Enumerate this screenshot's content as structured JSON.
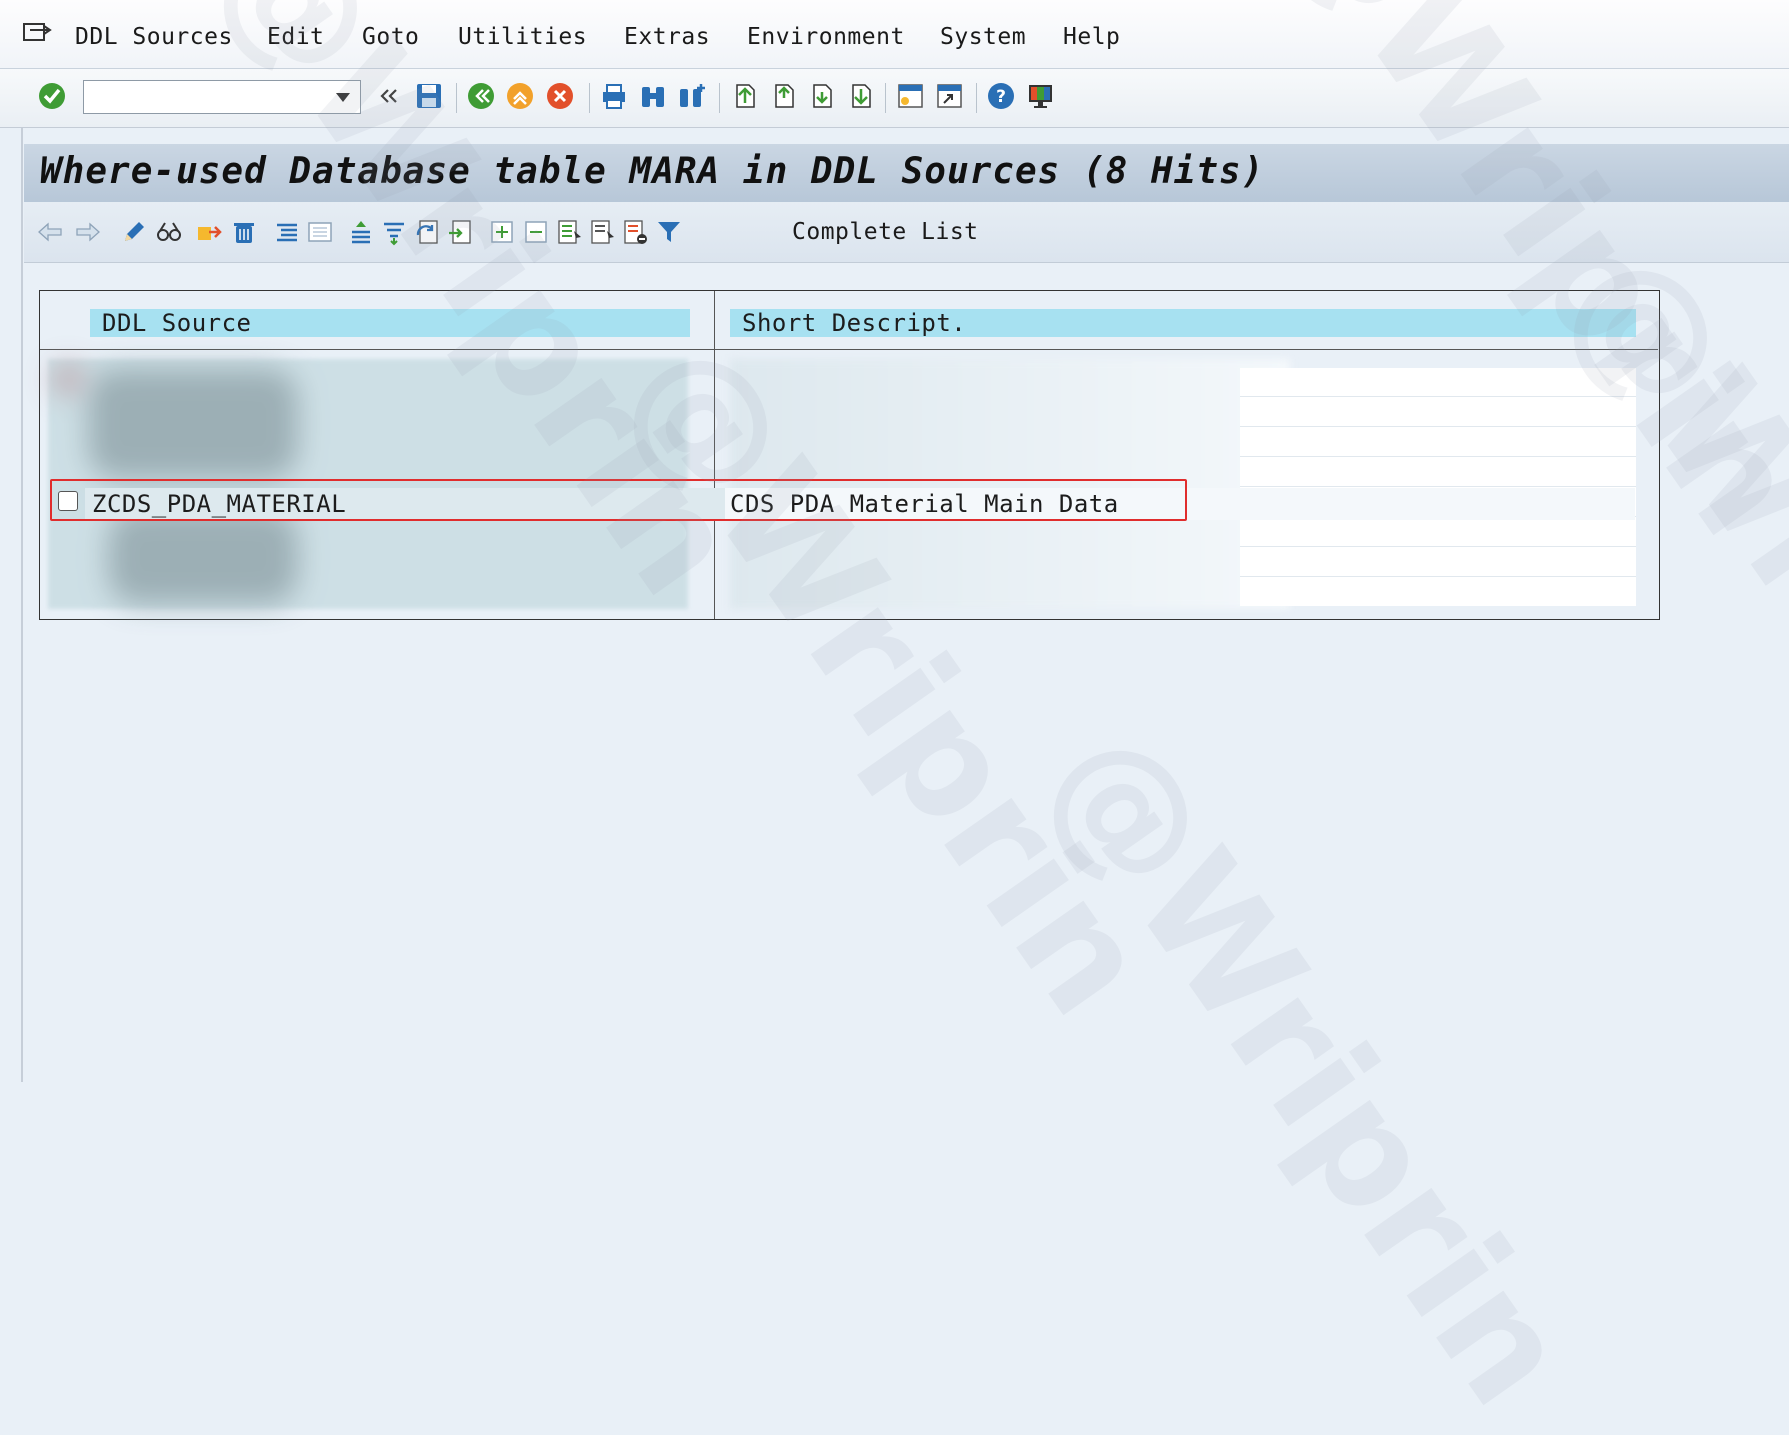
{
  "menubar": {
    "items": [
      {
        "label": "DDL Sources"
      },
      {
        "label": "Edit"
      },
      {
        "label": "Goto"
      },
      {
        "label": "Utilities"
      },
      {
        "label": "Extras"
      },
      {
        "label": "Environment"
      },
      {
        "label": "System"
      },
      {
        "label": "Help"
      }
    ]
  },
  "toolbar": {
    "command_field_value": "",
    "icons": [
      "enter-icon",
      "back-double-chevron-icon",
      "save-icon",
      "back-icon",
      "exit-icon",
      "cancel-icon",
      "print-icon",
      "find-icon",
      "find-next-icon",
      "first-page-icon",
      "previous-page-icon",
      "next-page-icon",
      "last-page-icon",
      "create-session-icon",
      "shortcut-icon",
      "help-icon",
      "customize-layout-icon"
    ]
  },
  "page": {
    "title": "Where-used Database table MARA in DDL Sources (8 Hits)"
  },
  "app_toolbar": {
    "complete_list_label": "Complete List"
  },
  "grid": {
    "columns": [
      "DDL Source",
      "Short Descript."
    ],
    "visible_row": {
      "ddl_source": "ZCDS_PDA_MATERIAL",
      "short_description": "CDS PDA Material Main Data"
    }
  },
  "watermark": "@Wriprin",
  "colors": {
    "header_cell": "#a7e1f1",
    "title_bar": "#b7c7d8",
    "highlight": "#e02d2d",
    "background": "#e9f0f7"
  }
}
